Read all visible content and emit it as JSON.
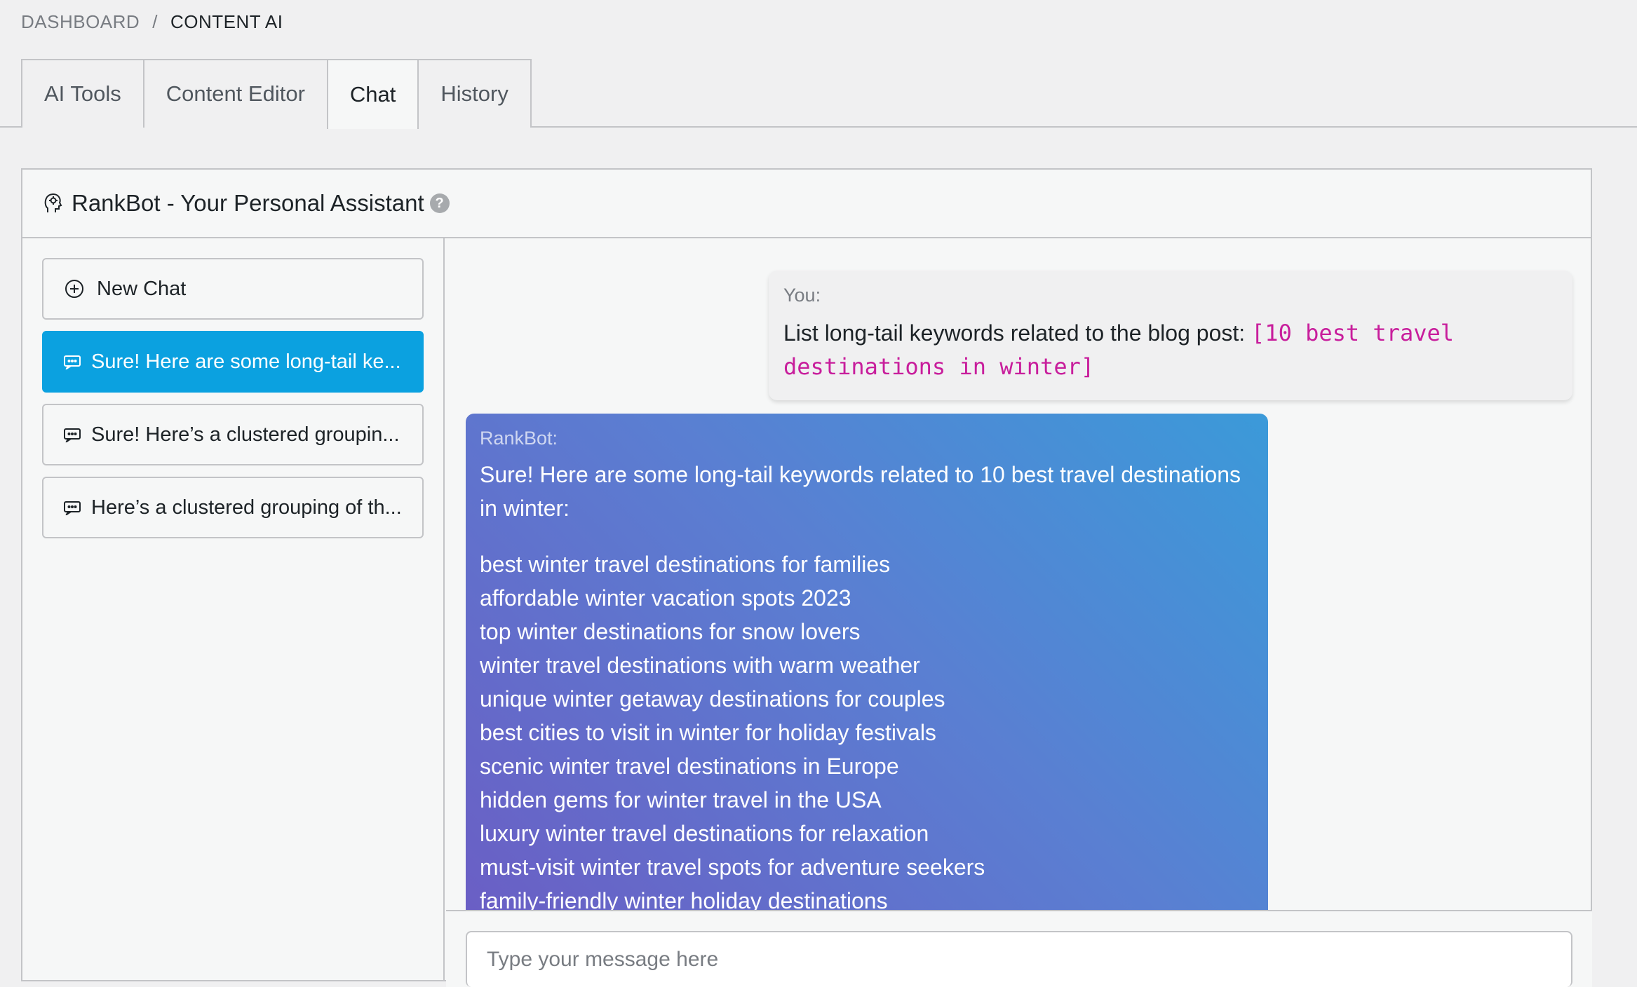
{
  "breadcrumb": {
    "root": "DASHBOARD",
    "separator": "/",
    "current": "CONTENT AI"
  },
  "tabs": [
    {
      "label": "AI Tools",
      "active": false
    },
    {
      "label": "Content Editor",
      "active": false
    },
    {
      "label": "Chat",
      "active": true
    },
    {
      "label": "History",
      "active": false
    }
  ],
  "panel": {
    "title": "RankBot - Your Personal Assistant",
    "help": "?"
  },
  "sidebar": {
    "new_chat_label": "New Chat",
    "chats": [
      {
        "label": "Sure! Here are some long-tail ke...",
        "active": true
      },
      {
        "label": "Sure! Here’s a clustered groupin...",
        "active": false
      },
      {
        "label": "Here’s a clustered grouping of th...",
        "active": false
      }
    ]
  },
  "conversation": {
    "user": {
      "sender": "You:",
      "text": "List long-tail keywords related to the blog post: ",
      "code": "[10 best travel destinations in winter]"
    },
    "bot": {
      "sender": "RankBot:",
      "intro": "Sure! Here are some long-tail keywords related to 10 best travel destinations in winter:",
      "keywords": [
        "best winter travel destinations for families",
        "affordable winter vacation spots 2023",
        "top winter destinations for snow lovers",
        "winter travel destinations with warm weather",
        "unique winter getaway destinations for couples",
        "best cities to visit in winter for holiday festivals",
        "scenic winter travel destinations in Europe",
        "hidden gems for winter travel in the USA",
        "luxury winter travel destinations for relaxation",
        "must-visit winter travel spots for adventure seekers",
        "family-friendly winter holiday destinations"
      ]
    }
  },
  "composer": {
    "placeholder": "Type your message here"
  },
  "colors": {
    "accent": "#0ba1e0",
    "code": "#c81e9c",
    "bot_gradient_start": "#3b9ad9",
    "bot_gradient_end": "#6b5dc4"
  }
}
